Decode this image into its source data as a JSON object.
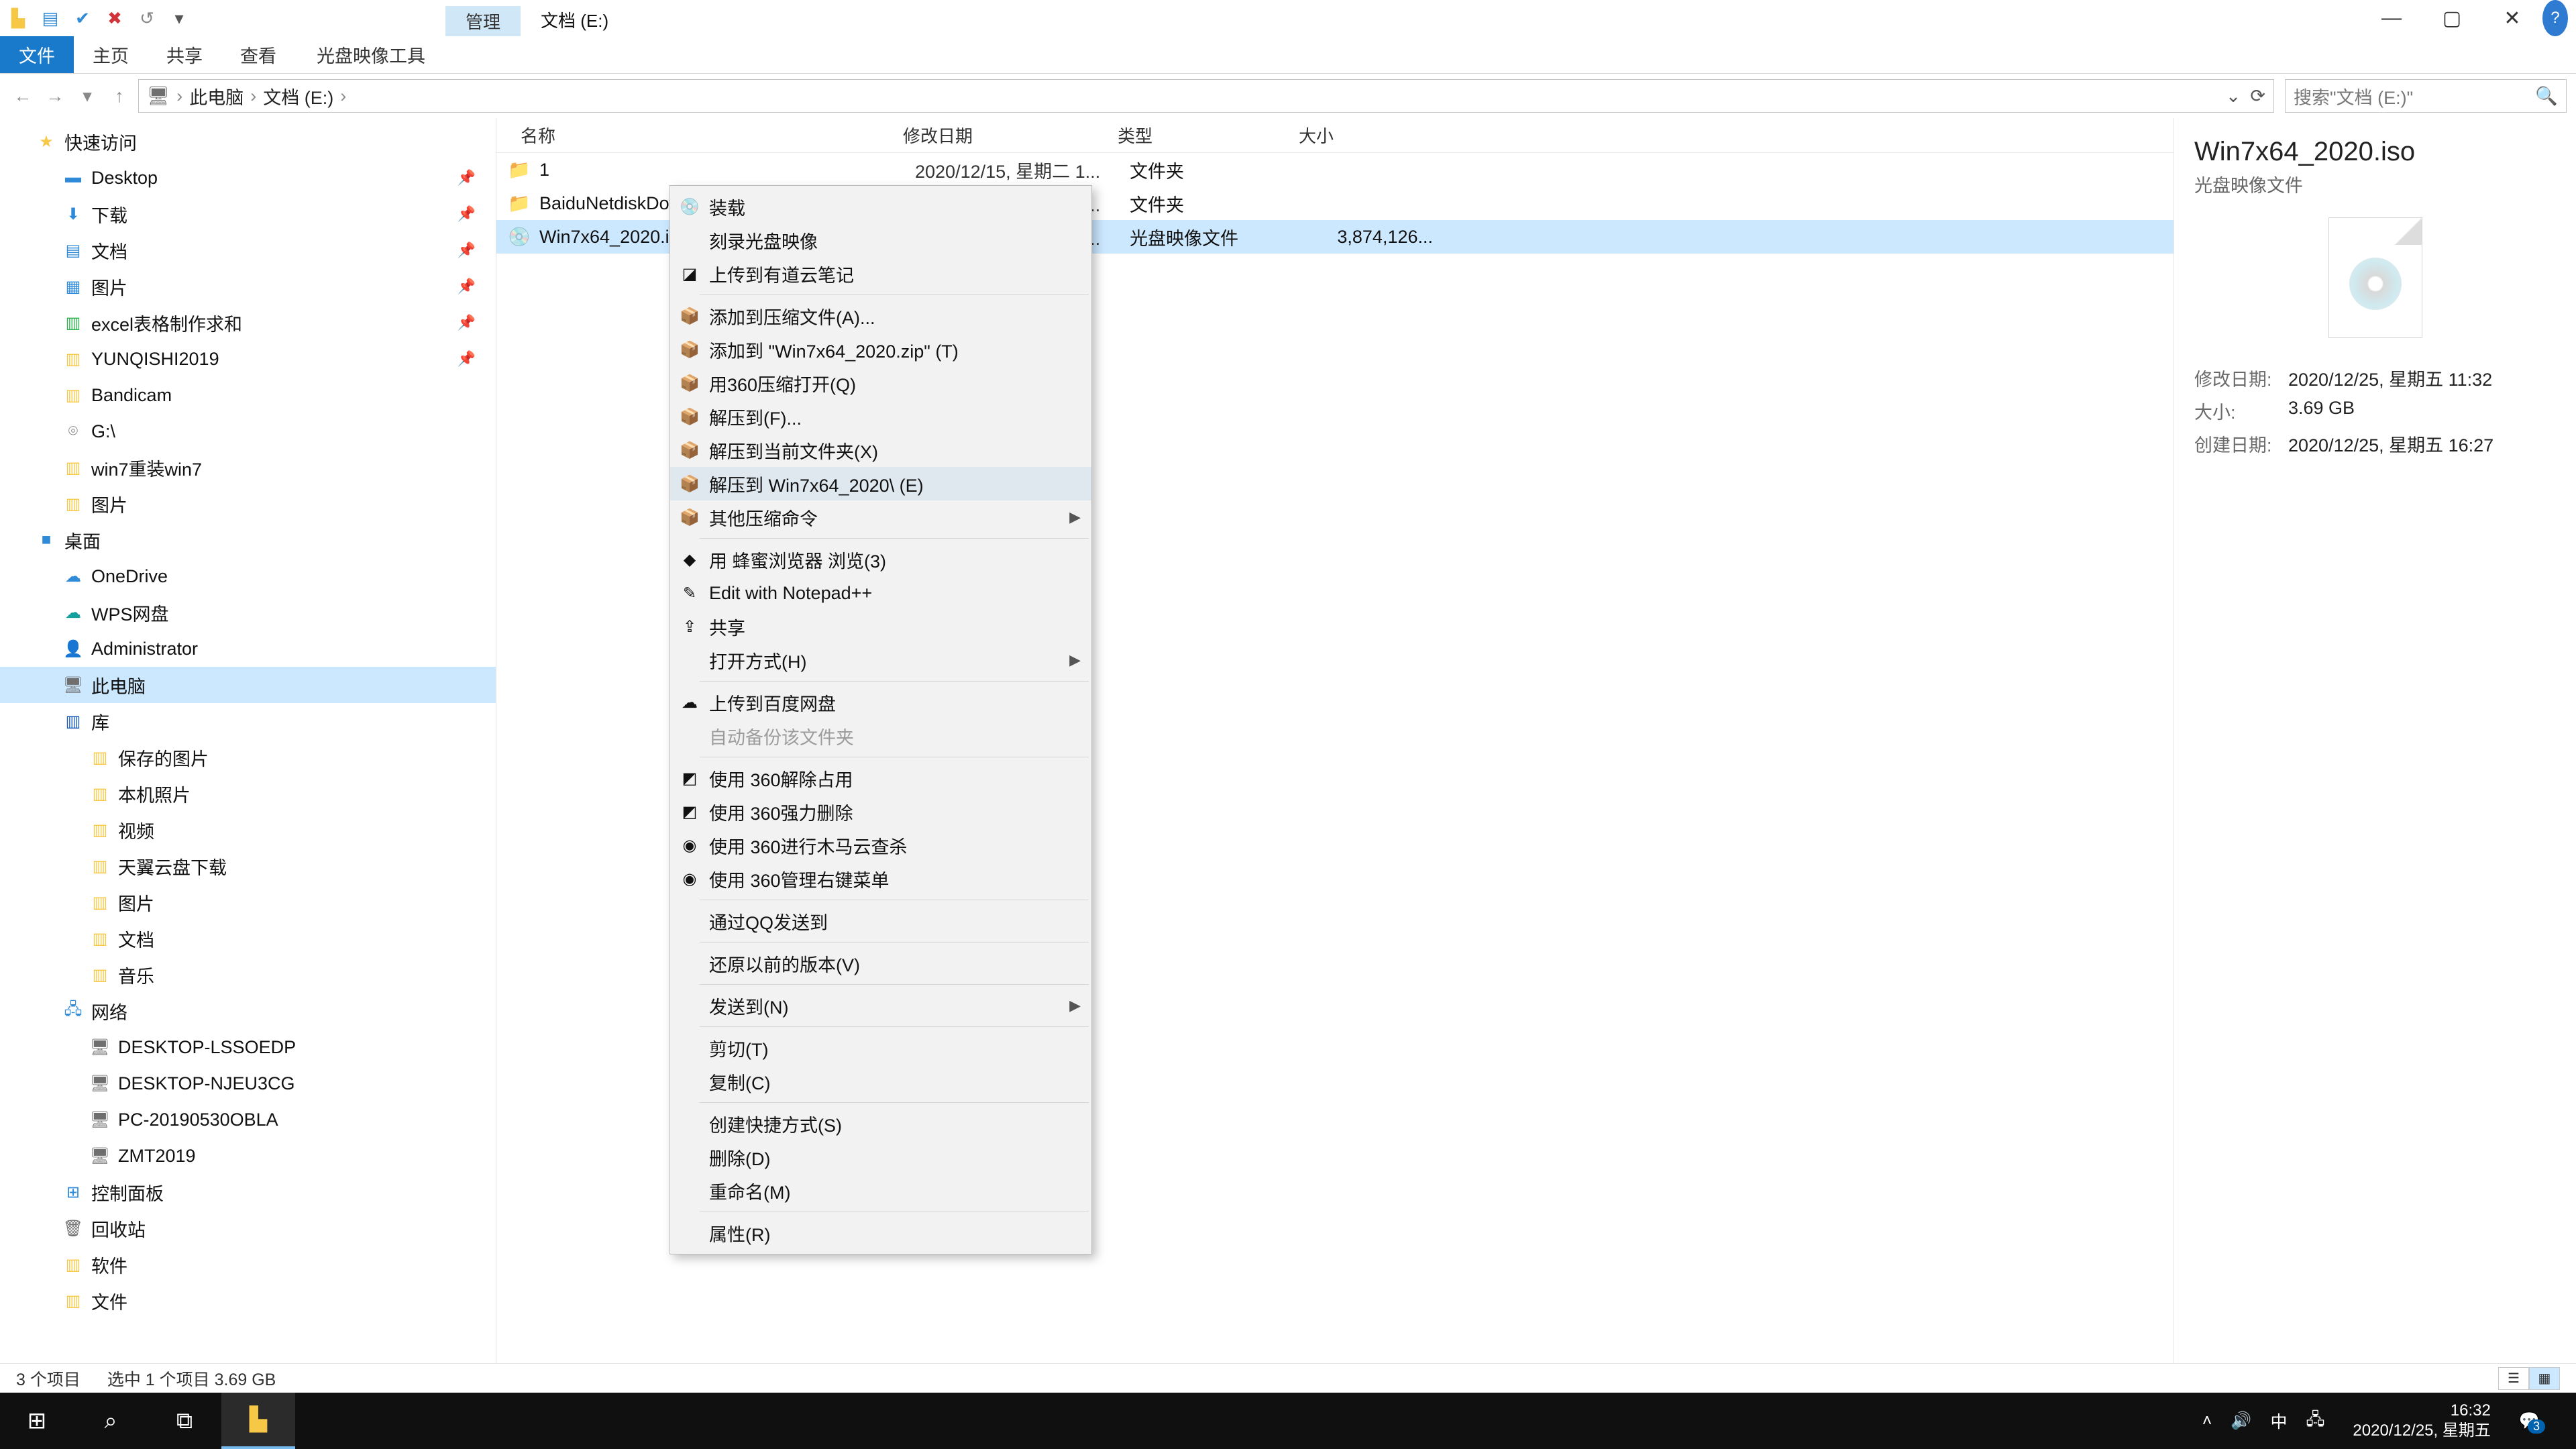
{
  "titlebar": {
    "manage_tab": "管理",
    "title": "文档 (E:)"
  },
  "window_controls": {
    "min": "—",
    "max": "▢",
    "close": "✕",
    "help": "?"
  },
  "ribbon": {
    "file": "文件",
    "home": "主页",
    "share": "共享",
    "view": "查看",
    "disc_tools": "光盘映像工具"
  },
  "breadcrumb": {
    "root": "此电脑",
    "drive": "文档 (E:)",
    "sep": "›"
  },
  "search": {
    "placeholder": "搜索\"文档 (E:)\""
  },
  "tree": [
    {
      "depth": 1,
      "icon": "★",
      "cls": "c-yellow",
      "label": "快速访问"
    },
    {
      "depth": 2,
      "icon": "▬",
      "cls": "c-blue",
      "label": "Desktop",
      "pin": true
    },
    {
      "depth": 2,
      "icon": "⬇",
      "cls": "c-blue",
      "label": "下载",
      "pin": true
    },
    {
      "depth": 2,
      "icon": "▤",
      "cls": "c-blue",
      "label": "文档",
      "pin": true
    },
    {
      "depth": 2,
      "icon": "▦",
      "cls": "c-blue",
      "label": "图片",
      "pin": true
    },
    {
      "depth": 2,
      "icon": "▥",
      "cls": "c-green",
      "label": "excel表格制作求和",
      "pin": true
    },
    {
      "depth": 2,
      "icon": "▥",
      "cls": "c-yellow",
      "label": "YUNQISHI2019",
      "pin": true
    },
    {
      "depth": 2,
      "icon": "▥",
      "cls": "c-yellow",
      "label": "Bandicam"
    },
    {
      "depth": 2,
      "icon": "⌾",
      "cls": "c-gray",
      "label": "G:\\"
    },
    {
      "depth": 2,
      "icon": "▥",
      "cls": "c-yellow",
      "label": "win7重装win7"
    },
    {
      "depth": 2,
      "icon": "▥",
      "cls": "c-yellow",
      "label": "图片"
    },
    {
      "depth": 1,
      "icon": "■",
      "cls": "c-blue",
      "label": "桌面"
    },
    {
      "depth": 2,
      "icon": "☁",
      "cls": "c-blue",
      "label": "OneDrive"
    },
    {
      "depth": 2,
      "icon": "☁",
      "cls": "c-teal",
      "label": "WPS网盘"
    },
    {
      "depth": 2,
      "icon": "👤",
      "cls": "c-gray",
      "label": "Administrator"
    },
    {
      "depth": 2,
      "icon": "🖥",
      "cls": "c-gray",
      "label": "此电脑",
      "sel": true
    },
    {
      "depth": 2,
      "icon": "▥",
      "cls": "c-dblue",
      "label": "库"
    },
    {
      "depth": 2,
      "icon": "▥",
      "cls": "c-yellow",
      "label": "保存的图片",
      "d3": true
    },
    {
      "depth": 2,
      "icon": "▥",
      "cls": "c-yellow",
      "label": "本机照片",
      "d3": true
    },
    {
      "depth": 2,
      "icon": "▥",
      "cls": "c-yellow",
      "label": "视频",
      "d3": true
    },
    {
      "depth": 2,
      "icon": "▥",
      "cls": "c-yellow",
      "label": "天翼云盘下载",
      "d3": true
    },
    {
      "depth": 2,
      "icon": "▥",
      "cls": "c-yellow",
      "label": "图片",
      "d3": true
    },
    {
      "depth": 2,
      "icon": "▥",
      "cls": "c-yellow",
      "label": "文档",
      "d3": true
    },
    {
      "depth": 2,
      "icon": "▥",
      "cls": "c-yellow",
      "label": "音乐",
      "d3": true
    },
    {
      "depth": 2,
      "icon": "🖧",
      "cls": "c-blue",
      "label": "网络"
    },
    {
      "depth": 2,
      "icon": "🖥",
      "cls": "c-gray",
      "label": "DESKTOP-LSSOEDP",
      "d3": true
    },
    {
      "depth": 2,
      "icon": "🖥",
      "cls": "c-gray",
      "label": "DESKTOP-NJEU3CG",
      "d3": true
    },
    {
      "depth": 2,
      "icon": "🖥",
      "cls": "c-gray",
      "label": "PC-20190530OBLA",
      "d3": true
    },
    {
      "depth": 2,
      "icon": "🖥",
      "cls": "c-gray",
      "label": "ZMT2019",
      "d3": true
    },
    {
      "depth": 2,
      "icon": "⊞",
      "cls": "c-blue",
      "label": "控制面板"
    },
    {
      "depth": 2,
      "icon": "🗑",
      "cls": "c-gray",
      "label": "回收站"
    },
    {
      "depth": 2,
      "icon": "▥",
      "cls": "c-yellow",
      "label": "软件"
    },
    {
      "depth": 2,
      "icon": "▥",
      "cls": "c-yellow",
      "label": "文件"
    }
  ],
  "columns": {
    "name": "名称",
    "date": "修改日期",
    "type": "类型",
    "size": "大小"
  },
  "rows": [
    {
      "icon": "📁",
      "name": "1",
      "date": "2020/12/15, 星期二 1...",
      "type": "文件夹",
      "size": ""
    },
    {
      "icon": "📁",
      "name": "BaiduNetdiskDownload",
      "date": "2020/12/25, 星期五 1...",
      "type": "文件夹",
      "size": ""
    },
    {
      "icon": "💿",
      "name": "Win7x64_2020.iso",
      "date": "2020/12/25, 星期五 1...",
      "type": "光盘映像文件",
      "size": "3,874,126...",
      "sel": true
    }
  ],
  "ctx": [
    {
      "t": "装载",
      "ic": "💿"
    },
    {
      "t": "刻录光盘映像"
    },
    {
      "t": "上传到有道云笔记",
      "ic": "◪"
    },
    {
      "sep": true
    },
    {
      "t": "添加到压缩文件(A)...",
      "ic": "📦"
    },
    {
      "t": "添加到 \"Win7x64_2020.zip\" (T)",
      "ic": "📦"
    },
    {
      "t": "用360压缩打开(Q)",
      "ic": "📦"
    },
    {
      "t": "解压到(F)...",
      "ic": "📦"
    },
    {
      "t": "解压到当前文件夹(X)",
      "ic": "📦"
    },
    {
      "t": "解压到 Win7x64_2020\\ (E)",
      "ic": "📦",
      "hl": true
    },
    {
      "t": "其他压缩命令",
      "ic": "📦",
      "sub": true
    },
    {
      "sep": true
    },
    {
      "t": "用 蜂蜜浏览器 浏览(3)",
      "ic": "◆"
    },
    {
      "t": "Edit with Notepad++",
      "ic": "✎"
    },
    {
      "t": "共享",
      "ic": "⇪"
    },
    {
      "t": "打开方式(H)",
      "sub": true
    },
    {
      "sep": true
    },
    {
      "t": "上传到百度网盘",
      "ic": "☁"
    },
    {
      "t": "自动备份该文件夹",
      "disabled": true
    },
    {
      "sep": true
    },
    {
      "t": "使用 360解除占用",
      "ic": "◩"
    },
    {
      "t": "使用 360强力删除",
      "ic": "◩"
    },
    {
      "t": "使用 360进行木马云查杀",
      "ic": "◉"
    },
    {
      "t": "使用 360管理右键菜单",
      "ic": "◉"
    },
    {
      "sep": true
    },
    {
      "t": "通过QQ发送到"
    },
    {
      "sep": true
    },
    {
      "t": "还原以前的版本(V)"
    },
    {
      "sep": true
    },
    {
      "t": "发送到(N)",
      "sub": true
    },
    {
      "sep": true
    },
    {
      "t": "剪切(T)"
    },
    {
      "t": "复制(C)"
    },
    {
      "sep": true
    },
    {
      "t": "创建快捷方式(S)"
    },
    {
      "t": "删除(D)"
    },
    {
      "t": "重命名(M)"
    },
    {
      "sep": true
    },
    {
      "t": "属性(R)"
    }
  ],
  "details": {
    "title": "Win7x64_2020.iso",
    "subtitle": "光盘映像文件",
    "mod_k": "修改日期:",
    "mod_v": "2020/12/25, 星期五 11:32",
    "size_k": "大小:",
    "size_v": "3.69 GB",
    "create_k": "创建日期:",
    "create_v": "2020/12/25, 星期五 16:27"
  },
  "status": {
    "count": "3 个项目",
    "sel": "选中 1 个项目  3.69 GB"
  },
  "taskbar": {
    "time": "16:32",
    "date": "2020/12/25, 星期五",
    "ime": "中"
  }
}
